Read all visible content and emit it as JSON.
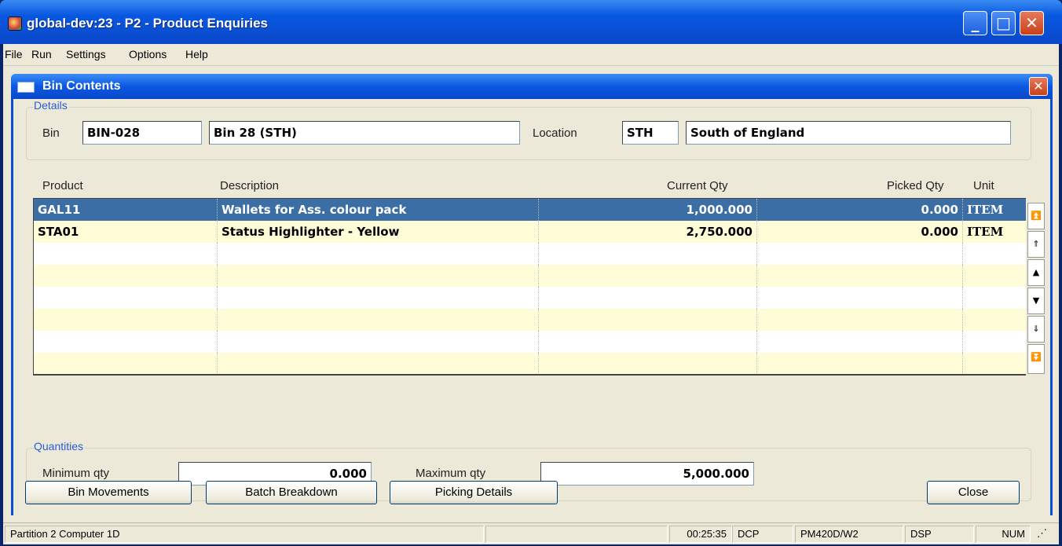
{
  "window": {
    "title": "global-dev:23 - P2 - Product Enquiries",
    "min_glyph": "_",
    "max_glyph": "□",
    "close_glyph": "✕"
  },
  "menu": [
    "File",
    "Run",
    "Settings",
    "Options",
    "Help"
  ],
  "dialog": {
    "title": "Bin Contents",
    "close_glyph": "✕"
  },
  "details": {
    "group_label": "Details",
    "bin_label": "Bin",
    "bin_code": "BIN-028",
    "bin_name": "Bin 28 (STH)",
    "location_label": "Location",
    "location_code": "STH",
    "location_name": "South of England"
  },
  "grid": {
    "headers": [
      "Product",
      "Description",
      "Current Qty",
      "Picked Qty",
      "Unit"
    ],
    "rows": [
      {
        "product": "GAL11",
        "description": "Wallets for Ass. colour pack",
        "current_qty": "1,000.000",
        "picked_qty": "0.000",
        "unit": "ITEM",
        "selected": true
      },
      {
        "product": "STA01",
        "description": "Status Highlighter - Yellow",
        "current_qty": "2,750.000",
        "picked_qty": "0.000",
        "unit": "ITEM",
        "selected": false
      }
    ]
  },
  "scroll_icons": [
    "first-icon",
    "page-up-icon",
    "up-icon",
    "down-icon",
    "page-down-icon",
    "last-icon"
  ],
  "quantities": {
    "group_label": "Quantities",
    "min_label": "Minimum qty",
    "min_value": "0.000",
    "max_label": "Maximum qty",
    "max_value": "5,000.000"
  },
  "buttons": {
    "bin_movements": "Bin Movements",
    "batch_breakdown": "Batch Breakdown",
    "picking_details": "Picking Details",
    "close": "Close"
  },
  "status": {
    "partition": "Partition 2 Computer 1D",
    "time": "00:25:35",
    "mode": "DCP",
    "program": "PM420D/W2",
    "dsp": "DSP",
    "num": "NUM"
  }
}
